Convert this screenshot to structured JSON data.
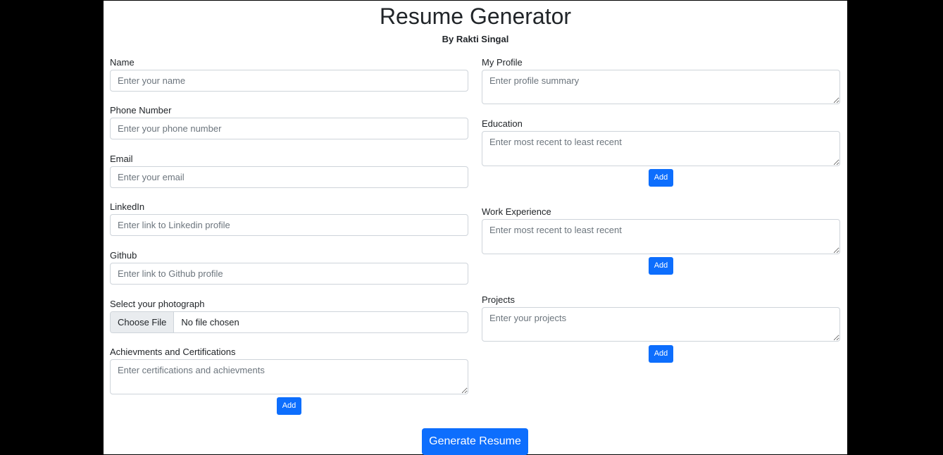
{
  "header": {
    "title": "Resume Generator",
    "subtitle": "By Rakti Singal"
  },
  "left": {
    "name": {
      "label": "Name",
      "placeholder": "Enter your name"
    },
    "phone": {
      "label": "Phone Number",
      "placeholder": "Enter your phone number"
    },
    "email": {
      "label": "Email",
      "placeholder": "Enter your email"
    },
    "linkedin": {
      "label": "LinkedIn",
      "placeholder": "Enter link to Linkedin profile"
    },
    "github": {
      "label": "Github",
      "placeholder": "Enter link to Github profile"
    },
    "photo": {
      "label": "Select your photograph",
      "button": "Choose File",
      "status": "No file chosen"
    },
    "achievements": {
      "label": "Achievments and Certifications",
      "placeholder": "Enter certifications and achievments",
      "add": "Add"
    }
  },
  "right": {
    "profile": {
      "label": "My Profile",
      "placeholder": "Enter profile summary"
    },
    "education": {
      "label": "Education",
      "placeholder": "Enter most recent to least recent",
      "add": "Add"
    },
    "work": {
      "label": "Work Experience",
      "placeholder": "Enter most recent to least recent",
      "add": "Add"
    },
    "projects": {
      "label": "Projects",
      "placeholder": "Enter your projects",
      "add": "Add"
    }
  },
  "actions": {
    "generate": "Generate Resume"
  },
  "colors": {
    "primary": "#0d6efd",
    "background": "#000000",
    "page": "#ffffff",
    "border": "#ced4da",
    "placeholder": "#6c757d"
  }
}
